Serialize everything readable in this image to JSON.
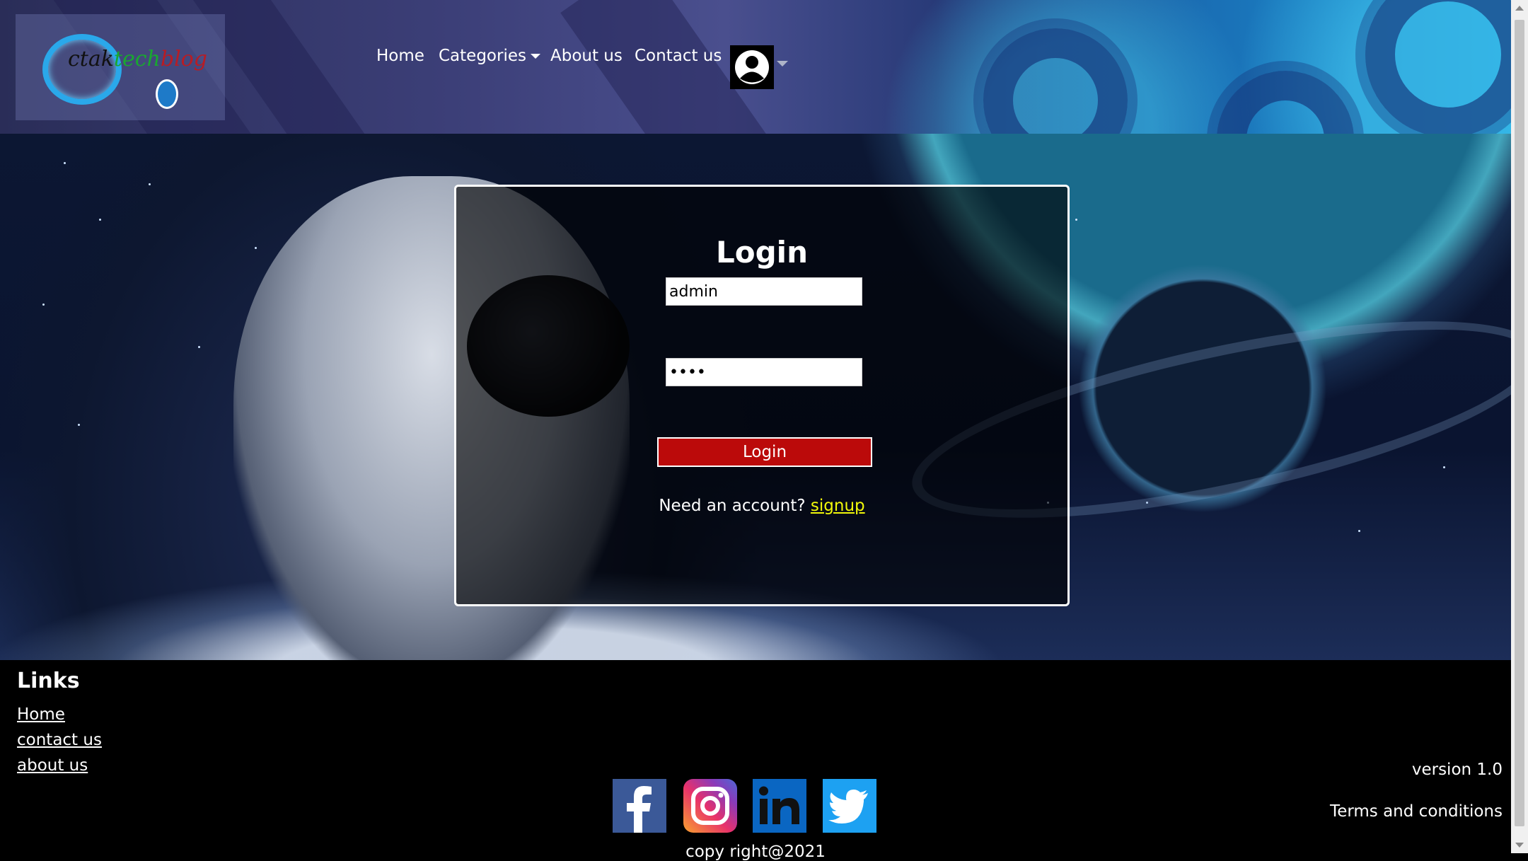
{
  "header": {
    "logo_text": {
      "part1": "ctak",
      "part2": "tech",
      "part3": "blog"
    },
    "nav": {
      "home": "Home",
      "categories": "Categories",
      "about": "About us",
      "contact": "Contact us"
    }
  },
  "login": {
    "title": "Login",
    "username_value": "admin",
    "password_value": "abcd",
    "button_label": "Login",
    "need_account": "Need an account?",
    "signup_link": "signup"
  },
  "footer": {
    "links_heading": "Links",
    "links": [
      "Home",
      "contact us",
      "about us"
    ],
    "social": [
      "facebook-icon",
      "instagram-icon",
      "linkedin-icon",
      "twitter-icon"
    ],
    "version": "version 1.0",
    "terms": "Terms and conditions",
    "copyright": "copy right@2021"
  },
  "colors": {
    "login_button": "#bb0a0a",
    "signup_link": "#f1f80a",
    "footer_bg": "#000000"
  }
}
